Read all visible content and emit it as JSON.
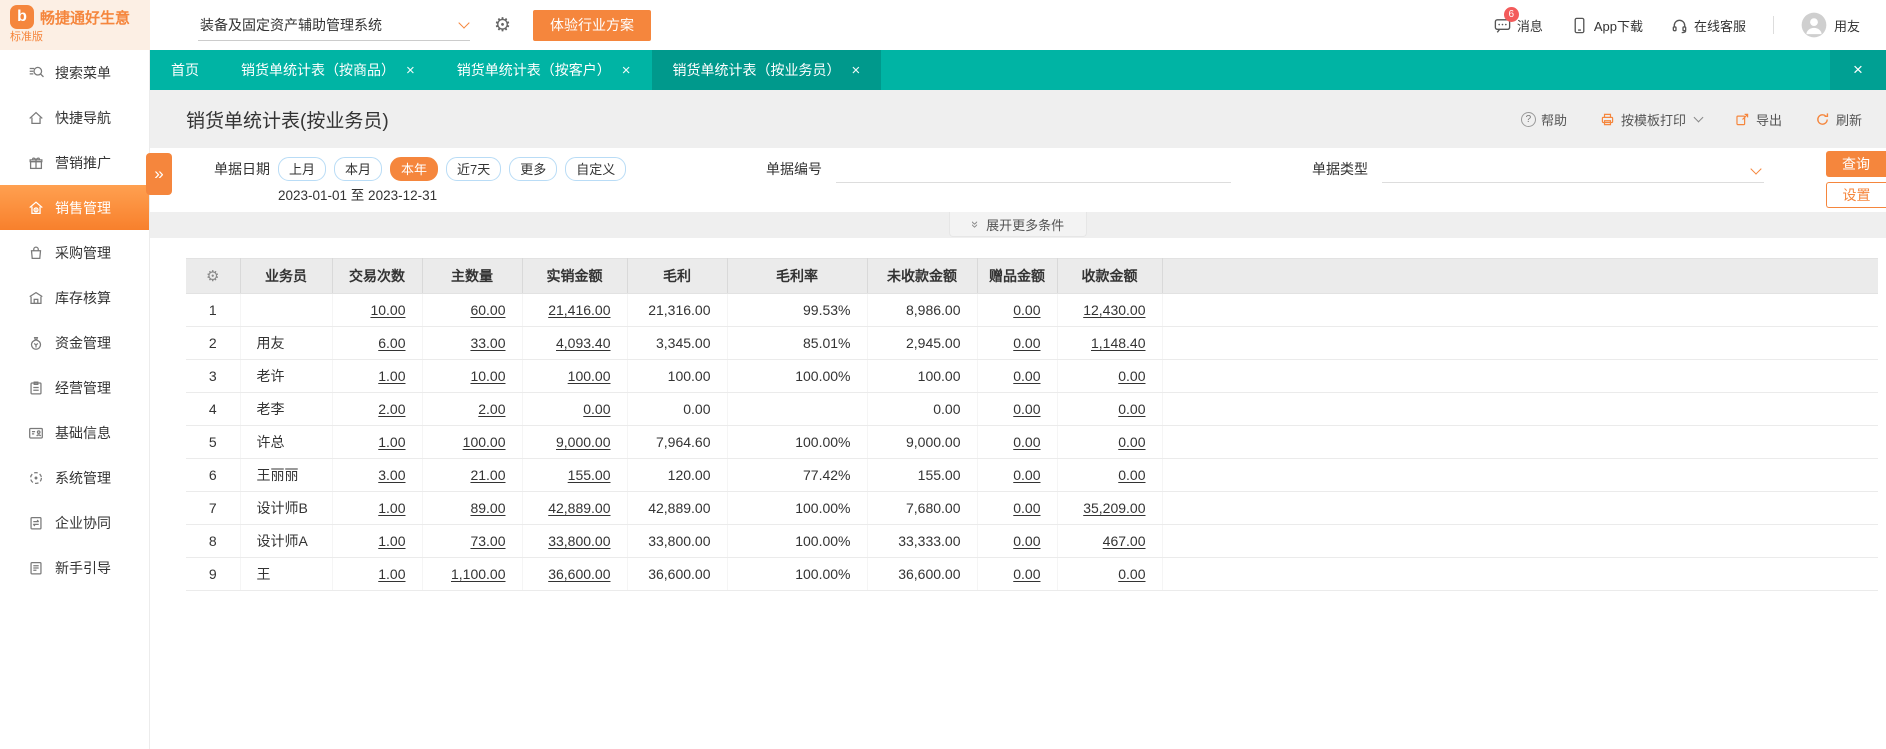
{
  "colors": {
    "teal": "#00b4a4",
    "teal_active_tab": "#00998c",
    "orange": "#f5863d",
    "page_bg": "#efefef",
    "badge_red": "#f35b5b"
  },
  "glyphs": {
    "gear": "⚙",
    "close": "×",
    "expand": "»",
    "double_chevron": "»",
    "help": "?",
    "logo": "b"
  },
  "topbar": {
    "brand": "畅捷通好生意",
    "edition": "标准版",
    "system_select": "装备及固定资产辅助管理系统",
    "trial_button": "体验行业方案",
    "messages_label": "消息",
    "messages_badge": "6",
    "app_download_label": "App下载",
    "online_service_label": "在线客服",
    "username": "用友"
  },
  "tabs": [
    {
      "label": "首页",
      "active": false,
      "closable": false
    },
    {
      "label": "销货单统计表（按商品）",
      "active": false,
      "closable": true
    },
    {
      "label": "销货单统计表（按客户）",
      "active": false,
      "closable": true
    },
    {
      "label": "销货单统计表（按业务员）",
      "active": true,
      "closable": true
    }
  ],
  "sidebar": {
    "items": [
      {
        "label": "搜索菜单",
        "icon": "search",
        "active": false
      },
      {
        "label": "快捷导航",
        "icon": "home",
        "active": false
      },
      {
        "label": "营销推广",
        "icon": "gift",
        "active": false
      },
      {
        "label": "销售管理",
        "icon": "sales-house",
        "active": true
      },
      {
        "label": "采购管理",
        "icon": "purchase-bag",
        "active": false
      },
      {
        "label": "库存核算",
        "icon": "warehouse",
        "active": false
      },
      {
        "label": "资金管理",
        "icon": "money-bag",
        "active": false
      },
      {
        "label": "经营管理",
        "icon": "clipboard",
        "active": false
      },
      {
        "label": "基础信息",
        "icon": "id-card",
        "active": false
      },
      {
        "label": "系统管理",
        "icon": "system-circle",
        "active": false
      },
      {
        "label": "企业协同",
        "icon": "sync-board",
        "active": false
      },
      {
        "label": "新手引导",
        "icon": "guide-book",
        "active": false
      }
    ]
  },
  "page": {
    "title": "销货单统计表(按业务员)",
    "toolbar": {
      "help": "帮助",
      "print": "按模板打印",
      "export": "导出",
      "refresh": "刷新"
    }
  },
  "filters": {
    "date_label": "单据日期",
    "date_options": [
      "上月",
      "本月",
      "本年",
      "近7天",
      "更多",
      "自定义"
    ],
    "date_selected": "本年",
    "date_range": "2023-01-01 至 2023-12-31",
    "doc_no_label": "单据编号",
    "doc_type_label": "单据类型",
    "query_button": "查询",
    "settings_button": "设置",
    "expand_more": "展开更多条件"
  },
  "table": {
    "columns": [
      "业务员",
      "交易次数",
      "主数量",
      "实销金额",
      "毛利",
      "毛利率",
      "未收款金额",
      "赠品金额",
      "收款金额"
    ],
    "rows": [
      {
        "no": "1",
        "name": "",
        "trades": "10.00",
        "qty": "60.00",
        "sales": "21,416.00",
        "profit": "21,316.00",
        "margin": "99.53%",
        "unpaid": "8,986.00",
        "gift": "0.00",
        "received": "12,430.00"
      },
      {
        "no": "2",
        "name": "用友",
        "trades": "6.00",
        "qty": "33.00",
        "sales": "4,093.40",
        "profit": "3,345.00",
        "margin": "85.01%",
        "unpaid": "2,945.00",
        "gift": "0.00",
        "received": "1,148.40"
      },
      {
        "no": "3",
        "name": "老许",
        "trades": "1.00",
        "qty": "10.00",
        "sales": "100.00",
        "profit": "100.00",
        "margin": "100.00%",
        "unpaid": "100.00",
        "gift": "0.00",
        "received": "0.00"
      },
      {
        "no": "4",
        "name": "老李",
        "trades": "2.00",
        "qty": "2.00",
        "sales": "0.00",
        "profit": "0.00",
        "margin": "",
        "unpaid": "0.00",
        "gift": "0.00",
        "received": "0.00"
      },
      {
        "no": "5",
        "name": "许总",
        "trades": "1.00",
        "qty": "100.00",
        "sales": "9,000.00",
        "profit": "7,964.60",
        "margin": "100.00%",
        "unpaid": "9,000.00",
        "gift": "0.00",
        "received": "0.00"
      },
      {
        "no": "6",
        "name": "王丽丽",
        "trades": "3.00",
        "qty": "21.00",
        "sales": "155.00",
        "profit": "120.00",
        "margin": "77.42%",
        "unpaid": "155.00",
        "gift": "0.00",
        "received": "0.00"
      },
      {
        "no": "7",
        "name": "设计师B",
        "trades": "1.00",
        "qty": "89.00",
        "sales": "42,889.00",
        "profit": "42,889.00",
        "margin": "100.00%",
        "unpaid": "7,680.00",
        "gift": "0.00",
        "received": "35,209.00"
      },
      {
        "no": "8",
        "name": "设计师A",
        "trades": "1.00",
        "qty": "73.00",
        "sales": "33,800.00",
        "profit": "33,800.00",
        "margin": "100.00%",
        "unpaid": "33,333.00",
        "gift": "0.00",
        "received": "467.00"
      },
      {
        "no": "9",
        "name": "王",
        "trades": "1.00",
        "qty": "1,100.00",
        "sales": "36,600.00",
        "profit": "36,600.00",
        "margin": "100.00%",
        "unpaid": "36,600.00",
        "gift": "0.00",
        "received": "0.00"
      }
    ]
  }
}
